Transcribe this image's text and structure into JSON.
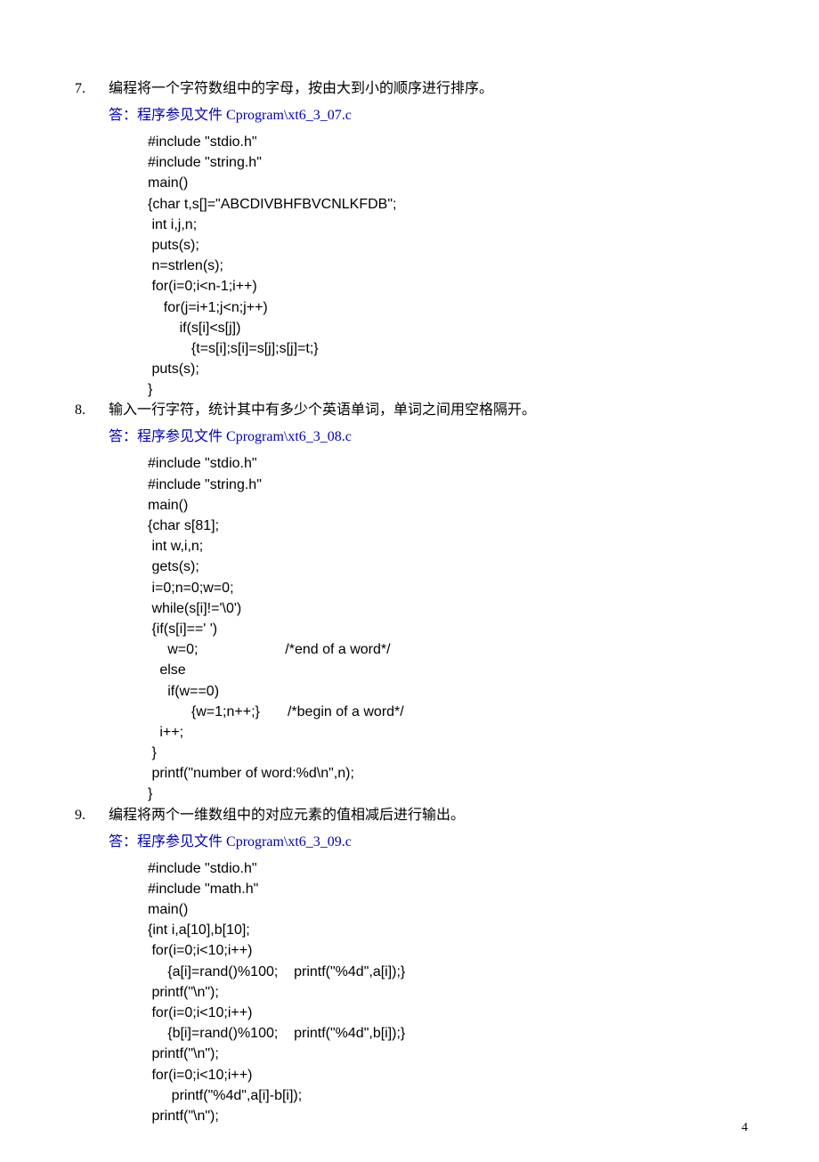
{
  "page_number": "4",
  "items": [
    {
      "num": "7.",
      "question": "编程将一个字符数组中的字母，按由大到小的顺序进行排序。",
      "answer_prefix": "答：程序参见文件 ",
      "answer_file": "Cprogram\\xt6_3_07.c",
      "code": "#include \"stdio.h\"\n#include \"string.h\"\nmain()\n{char t,s[]=\"ABCDIVBHFBVCNLKFDB\";\n int i,j,n;\n puts(s);\n n=strlen(s);\n for(i=0;i<n-1;i++)\n    for(j=i+1;j<n;j++)\n        if(s[i]<s[j])\n           {t=s[i];s[i]=s[j];s[j]=t;}\n puts(s);\n}"
    },
    {
      "num": "8.",
      "question": "输入一行字符，统计其中有多少个英语单词，单词之间用空格隔开。",
      "answer_prefix": "答：程序参见文件 ",
      "answer_file": "Cprogram\\xt6_3_08.c",
      "code": "#include \"stdio.h\"\n#include \"string.h\"\nmain()\n{char s[81];\n int w,i,n;\n gets(s);\n i=0;n=0;w=0;\n while(s[i]!='\\0')\n {if(s[i]==' ')\n     w=0;                      /*end of a word*/\n   else\n     if(w==0)\n           {w=1;n++;}       /*begin of a word*/\n   i++;\n }\n printf(\"number of word:%d\\n\",n);\n}"
    },
    {
      "num": "9.",
      "question": "编程将两个一维数组中的对应元素的值相减后进行输出。",
      "answer_prefix": "答：程序参见文件 ",
      "answer_file": "Cprogram\\xt6_3_09.c",
      "code": "#include \"stdio.h\"\n#include \"math.h\"\nmain()\n{int i,a[10],b[10];\n for(i=0;i<10;i++)\n     {a[i]=rand()%100;    printf(\"%4d\",a[i]);}\n printf(\"\\n\");\n for(i=0;i<10;i++)\n     {b[i]=rand()%100;    printf(\"%4d\",b[i]);}\n printf(\"\\n\");\n for(i=0;i<10;i++)\n      printf(\"%4d\",a[i]-b[i]);\n printf(\"\\n\");"
    }
  ]
}
